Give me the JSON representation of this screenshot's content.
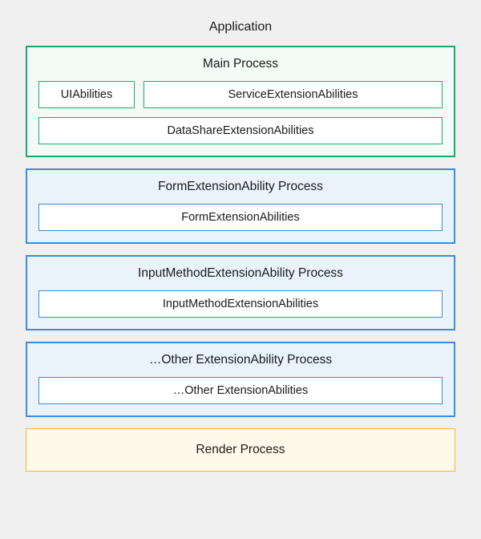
{
  "app": {
    "title": "Application"
  },
  "main": {
    "title": "Main Process",
    "ui": "UIAbilities",
    "service": "ServiceExtensionAbilities",
    "datashare": "DataShareExtensionAbilities"
  },
  "form": {
    "title": "FormExtensionAbility Process",
    "ability": "FormExtensionAbilities"
  },
  "ime": {
    "title": "InputMethodExtensionAbility Process",
    "ability": "InputMethodExtensionAbilities"
  },
  "other": {
    "title": "…Other ExtensionAbility Process",
    "ability": "…Other ExtensionAbilities"
  },
  "render": {
    "title": "Render Process"
  }
}
